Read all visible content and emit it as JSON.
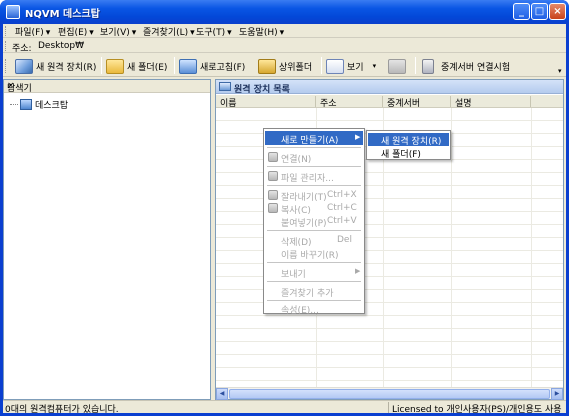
{
  "window": {
    "title": "NQVM 데스크탑"
  },
  "menubar": [
    {
      "label": "파일(F)"
    },
    {
      "label": "편집(E)"
    },
    {
      "label": "보기(V)"
    },
    {
      "label": "즐겨찾기(L)"
    },
    {
      "label": "도구(T)"
    },
    {
      "label": "도움말(H)"
    }
  ],
  "address": {
    "label": "주소:",
    "value": "Desktop₩"
  },
  "toolbar": {
    "new_remote": "새 원격 장치(R)",
    "new_folder": "새 폴더(E)",
    "refresh": "새로고침(F)",
    "up": "상위폴더",
    "view": "보기",
    "relay_test": "중계서버 연결시험"
  },
  "left_pane": {
    "title": "탐색기",
    "close": "×",
    "tree_root": "데스크탑"
  },
  "right_pane": {
    "title": "원격 장치 목록",
    "columns": [
      "이름",
      "주소",
      "중계서버",
      "설명"
    ]
  },
  "context_menu": {
    "items": [
      {
        "label": "새로 만들기(A)",
        "shortcut": "",
        "disabled": false,
        "submenu": true
      },
      {
        "label": "연결(N)",
        "shortcut": "",
        "disabled": true
      },
      {
        "label": "파일 관리자...",
        "shortcut": "",
        "disabled": true
      },
      {
        "label": "잘라내기(T)",
        "shortcut": "Ctrl+X",
        "disabled": true
      },
      {
        "label": "복사(C)",
        "shortcut": "Ctrl+C",
        "disabled": true
      },
      {
        "label": "붙여넣기(P)",
        "shortcut": "Ctrl+V",
        "disabled": true
      },
      {
        "label": "삭제(D)",
        "shortcut": "Del",
        "disabled": true
      },
      {
        "label": "이름 바꾸기(R)",
        "shortcut": "",
        "disabled": true
      },
      {
        "label": "보내기",
        "shortcut": "",
        "disabled": true,
        "submenu": true
      },
      {
        "label": "즐겨찾기 추가",
        "shortcut": "",
        "disabled": true
      },
      {
        "label": "속성(E)...",
        "shortcut": "",
        "disabled": true
      }
    ]
  },
  "submenu": {
    "items": [
      {
        "label": "새 원격 장치(R)"
      },
      {
        "label": "새 폴더(F)"
      }
    ]
  },
  "status": {
    "left": "0대의 원격컴퓨터가 있습니다.",
    "right": "Licensed to 개인사용자(PS)/개인용도 사용자용"
  },
  "colors": {
    "selection": "#316ac5",
    "titlebar": "#0a56e4"
  }
}
